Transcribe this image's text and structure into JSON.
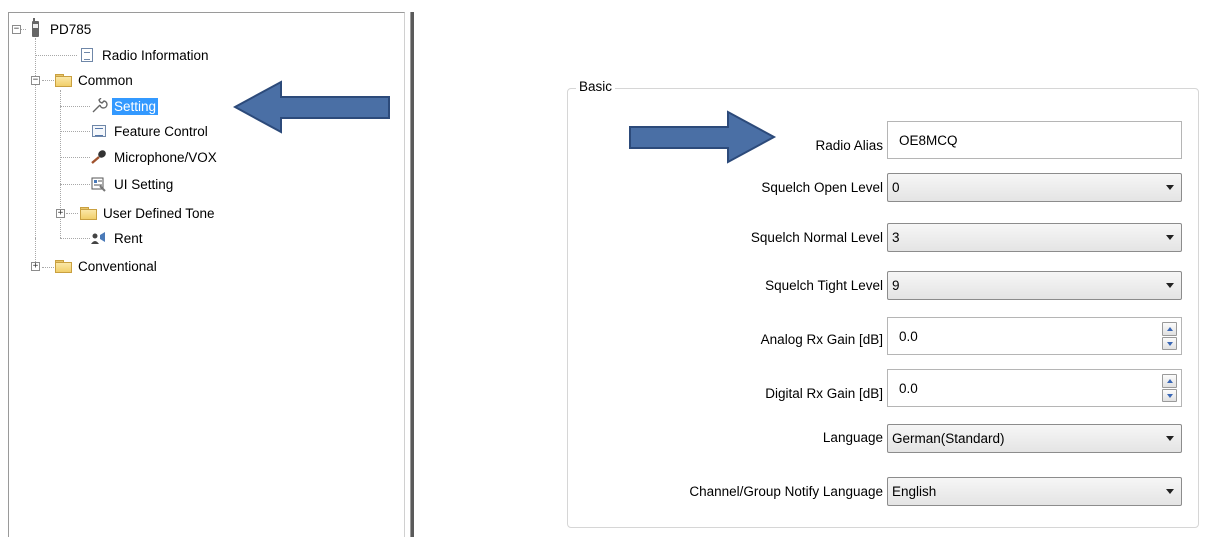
{
  "tree": {
    "root": {
      "label": "PD785",
      "icon": "radio-device-icon"
    },
    "items": [
      {
        "label": "Radio Information",
        "icon": "document-icon"
      },
      {
        "label": "Common",
        "icon": "folder-open-icon"
      },
      {
        "label": "Setting",
        "icon": "wrench-icon"
      },
      {
        "label": "Feature Control",
        "icon": "list-icon"
      },
      {
        "label": "Microphone/VOX",
        "icon": "microphone-icon"
      },
      {
        "label": "UI Setting",
        "icon": "ui-setting-icon"
      },
      {
        "label": "User Defined Tone",
        "icon": "folder-icon"
      },
      {
        "label": "Rent",
        "icon": "rent-icon"
      },
      {
        "label": "Conventional",
        "icon": "folder-icon"
      }
    ],
    "expander_collapsed": "+",
    "expander_expanded": "−"
  },
  "basic": {
    "title": "Basic",
    "fields": {
      "radio_alias": {
        "label": "Radio Alias",
        "value": "OE8MCQ"
      },
      "squelch_open": {
        "label": "Squelch Open Level",
        "value": "0"
      },
      "squelch_normal": {
        "label": "Squelch Normal Level",
        "value": "3"
      },
      "squelch_tight": {
        "label": "Squelch Tight Level",
        "value": "9"
      },
      "analog_rx_gain": {
        "label": "Analog Rx Gain [dB]",
        "value": "0.0"
      },
      "digital_rx_gain": {
        "label": "Digital Rx Gain [dB]",
        "value": "0.0"
      },
      "language": {
        "label": "Language",
        "value": "German(Standard)"
      },
      "notify_language": {
        "label": "Channel/Group Notify Language",
        "value": "English"
      }
    }
  },
  "colors": {
    "selection": "#3399ff",
    "arrow_fill": "#4a6fa5",
    "arrow_stroke": "#2c4a7a"
  }
}
